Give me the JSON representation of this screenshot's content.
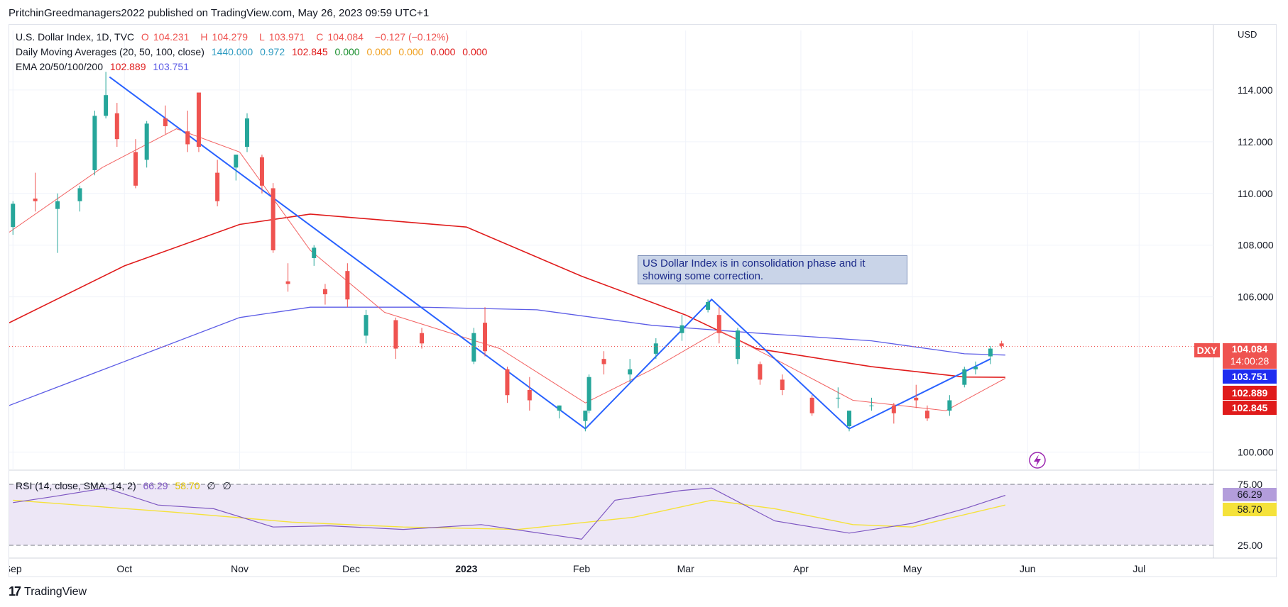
{
  "header": {
    "publisher": "PritchinGreedmanagers2022 published on TradingView.com, May 26, 2023 09:59 UTC+1"
  },
  "legend": {
    "symbol": "U.S. Dollar Index, 1D, TVC",
    "o_label": "O",
    "o": "104.231",
    "h_label": "H",
    "h": "104.279",
    "l_label": "L",
    "l": "103.971",
    "c_label": "C",
    "c": "104.084",
    "change": "−0.127 (−0.12%)",
    "ma_label": "Daily Moving Averages (20, 50, 100, close)",
    "ma_values": [
      "1440.000",
      "0.972",
      "102.845",
      "0.000",
      "0.000",
      "0.000",
      "0.000",
      "0.000"
    ],
    "ema_label": "EMA 20/50/100/200",
    "ema_values": [
      "102.889",
      "103.751"
    ],
    "rsi_label": "RSI (14, close, SMA, 14, 2)",
    "rsi_values": [
      "66.29",
      "58.70",
      "∅",
      "∅"
    ]
  },
  "annotation": {
    "line1": "US Dollar Index is in consolidation phase and it",
    "line2": "showing some correction."
  },
  "price_axis": {
    "currency": "USD",
    "ticks": [
      "114.000",
      "112.000",
      "110.000",
      "108.000",
      "106.000",
      "100.000"
    ]
  },
  "rsi_axis": {
    "ticks": [
      "75.00",
      "25.00"
    ]
  },
  "time_axis": {
    "labels": [
      "Sep",
      "Oct",
      "Nov",
      "Dec",
      "2023",
      "Feb",
      "Mar",
      "Apr",
      "May",
      "Jun",
      "Jul"
    ]
  },
  "price_tags": {
    "symbol": "DXY",
    "last": "104.084",
    "countdown": "14:00:28",
    "ema_blue": "103.751",
    "ema_red1": "102.889",
    "ma_red2": "102.845",
    "rsi": "66.29",
    "rsi_sma": "58.70"
  },
  "footer": {
    "brand": "TradingView"
  },
  "colors": {
    "up": "#26a69a",
    "down": "#ef5350",
    "ema_slow": "#5c5ce6",
    "ema_mid": "#e01b1b",
    "ema_fast": "#f26363",
    "trend": "#2962ff",
    "rsi": "#7e57c2",
    "rsi_sma": "#f5e23a"
  },
  "chart_data": {
    "type": "candlestick",
    "title": "U.S. Dollar Index, 1D, TVC",
    "y_range": [
      99.3,
      116.3
    ],
    "x_range": [
      "2022-08-31",
      "2023-07-21"
    ],
    "ohlc": [
      [
        "2022-09-01",
        108.7,
        109.7,
        108.4,
        109.6
      ],
      [
        "2022-09-07",
        109.8,
        110.8,
        109.3,
        109.7
      ],
      [
        "2022-09-13",
        109.4,
        110.0,
        107.7,
        109.7
      ],
      [
        "2022-09-19",
        109.7,
        110.3,
        109.3,
        110.2
      ],
      [
        "2022-09-23",
        110.9,
        113.2,
        110.7,
        113.0
      ],
      [
        "2022-09-26",
        113.0,
        114.7,
        112.9,
        113.8
      ],
      [
        "2022-09-29",
        113.1,
        113.5,
        111.8,
        112.1
      ],
      [
        "2022-10-04",
        111.6,
        112.1,
        110.2,
        110.3
      ],
      [
        "2022-10-07",
        111.3,
        112.8,
        111.0,
        112.7
      ],
      [
        "2022-10-12",
        112.9,
        113.4,
        112.3,
        112.6
      ],
      [
        "2022-10-18",
        112.4,
        113.2,
        111.6,
        111.9
      ],
      [
        "2022-10-21",
        113.9,
        113.9,
        111.6,
        111.8
      ],
      [
        "2022-10-26",
        110.8,
        111.3,
        109.5,
        109.7
      ],
      [
        "2022-10-31",
        111.0,
        111.5,
        110.5,
        111.5
      ],
      [
        "2022-11-03",
        111.8,
        113.1,
        111.6,
        112.9
      ],
      [
        "2022-11-07",
        111.4,
        111.5,
        110.0,
        110.3
      ],
      [
        "2022-11-10",
        110.2,
        110.4,
        107.7,
        107.8
      ],
      [
        "2022-11-14",
        106.6,
        107.3,
        106.2,
        106.5
      ],
      [
        "2022-11-21",
        107.5,
        108.0,
        107.2,
        107.9
      ],
      [
        "2022-11-24",
        106.3,
        106.5,
        105.7,
        106.1
      ],
      [
        "2022-11-30",
        107.0,
        107.3,
        105.6,
        105.9
      ],
      [
        "2022-12-05",
        104.5,
        105.5,
        104.2,
        105.3
      ],
      [
        "2022-12-13",
        105.1,
        105.2,
        103.6,
        104.0
      ],
      [
        "2022-12-20",
        104.6,
        104.8,
        104.0,
        104.2
      ],
      [
        "2023-01-03",
        103.5,
        104.8,
        103.4,
        104.6
      ],
      [
        "2023-01-06",
        105.0,
        105.6,
        103.7,
        103.9
      ],
      [
        "2023-01-12",
        103.2,
        103.3,
        101.9,
        102.2
      ],
      [
        "2023-01-18",
        102.4,
        102.9,
        101.6,
        102.0
      ],
      [
        "2023-01-26",
        101.6,
        101.8,
        101.3,
        101.8
      ],
      [
        "2023-02-02",
        101.2,
        101.6,
        100.8,
        101.6
      ],
      [
        "2023-02-03",
        101.6,
        103.0,
        101.5,
        102.9
      ],
      [
        "2023-02-07",
        103.6,
        103.9,
        103.0,
        103.4
      ],
      [
        "2023-02-14",
        103.0,
        103.6,
        102.7,
        103.2
      ],
      [
        "2023-02-21",
        103.8,
        104.4,
        103.6,
        104.2
      ],
      [
        "2023-02-28",
        104.6,
        105.3,
        104.3,
        104.9
      ],
      [
        "2023-03-07",
        105.5,
        105.9,
        105.4,
        105.8
      ],
      [
        "2023-03-10",
        105.3,
        105.6,
        104.2,
        104.6
      ],
      [
        "2023-03-15",
        103.6,
        104.8,
        103.4,
        104.7
      ],
      [
        "2023-03-21",
        103.4,
        103.5,
        102.6,
        102.8
      ],
      [
        "2023-03-27",
        102.8,
        103.0,
        102.2,
        102.4
      ],
      [
        "2023-04-04",
        102.1,
        102.2,
        101.4,
        101.5
      ],
      [
        "2023-04-11",
        102.1,
        102.5,
        101.7,
        102.1
      ],
      [
        "2023-04-14",
        101.0,
        101.6,
        100.8,
        101.6
      ],
      [
        "2023-04-20",
        101.8,
        102.1,
        101.6,
        101.8
      ],
      [
        "2023-04-26",
        101.8,
        101.9,
        101.1,
        101.5
      ],
      [
        "2023-05-02",
        102.1,
        102.6,
        101.7,
        102.0
      ],
      [
        "2023-05-05",
        101.6,
        101.8,
        101.2,
        101.3
      ],
      [
        "2023-05-11",
        101.6,
        102.2,
        101.4,
        102.0
      ],
      [
        "2023-05-15",
        102.6,
        103.3,
        102.5,
        103.2
      ],
      [
        "2023-05-18",
        103.2,
        103.5,
        103.0,
        103.3
      ],
      [
        "2023-05-22",
        103.7,
        104.1,
        103.4,
        104.0
      ],
      [
        "2023-05-25",
        104.2,
        104.3,
        104.0,
        104.1
      ]
    ],
    "series": [
      {
        "name": "EMA 200",
        "values": [
          [
            "2022-08-31",
            101.8
          ],
          [
            "2022-10-01",
            103.5
          ],
          [
            "2022-11-01",
            105.2
          ],
          [
            "2022-11-20",
            105.6
          ],
          [
            "2022-12-20",
            105.6
          ],
          [
            "2023-01-20",
            105.5
          ],
          [
            "2023-02-20",
            104.9
          ],
          [
            "2023-03-20",
            104.6
          ],
          [
            "2023-04-20",
            104.3
          ],
          [
            "2023-05-15",
            103.8
          ],
          [
            "2023-05-26",
            103.75
          ]
        ]
      },
      {
        "name": "EMA 100",
        "values": [
          [
            "2022-08-31",
            105.0
          ],
          [
            "2022-10-01",
            107.2
          ],
          [
            "2022-11-01",
            108.8
          ],
          [
            "2022-11-20",
            109.2
          ],
          [
            "2023-01-01",
            108.7
          ],
          [
            "2023-02-01",
            106.8
          ],
          [
            "2023-03-01",
            105.3
          ],
          [
            "2023-03-20",
            104.0
          ],
          [
            "2023-04-20",
            103.3
          ],
          [
            "2023-05-15",
            102.9
          ],
          [
            "2023-05-26",
            102.89
          ]
        ]
      },
      {
        "name": "MA 20",
        "values": [
          [
            "2022-08-31",
            108.5
          ],
          [
            "2022-09-25",
            111.0
          ],
          [
            "2022-10-15",
            112.5
          ],
          [
            "2022-11-01",
            111.6
          ],
          [
            "2022-11-20",
            107.8
          ],
          [
            "2022-12-10",
            105.4
          ],
          [
            "2023-01-10",
            104.0
          ],
          [
            "2023-02-02",
            101.9
          ],
          [
            "2023-02-20",
            103.2
          ],
          [
            "2023-03-10",
            104.7
          ],
          [
            "2023-03-25",
            103.6
          ],
          [
            "2023-04-15",
            102.0
          ],
          [
            "2023-05-10",
            101.6
          ],
          [
            "2023-05-26",
            102.85
          ]
        ]
      },
      {
        "name": "Trend",
        "values": [
          [
            "2022-09-27",
            114.5
          ],
          [
            "2023-02-02",
            100.9
          ],
          [
            "2023-03-08",
            105.9
          ],
          [
            "2023-04-14",
            100.9
          ],
          [
            "2023-05-22",
            103.6
          ]
        ]
      }
    ],
    "rsi": {
      "y_range": [
        25,
        75
      ],
      "values": [
        [
          "2022-09-01",
          60
        ],
        [
          "2022-09-12",
          65
        ],
        [
          "2022-09-26",
          72
        ],
        [
          "2022-10-10",
          58
        ],
        [
          "2022-10-25",
          55
        ],
        [
          "2022-11-10",
          40
        ],
        [
          "2022-11-25",
          41
        ],
        [
          "2022-12-15",
          38
        ],
        [
          "2023-01-05",
          42
        ],
        [
          "2023-02-01",
          30
        ],
        [
          "2023-02-10",
          62
        ],
        [
          "2023-02-28",
          70
        ],
        [
          "2023-03-08",
          72
        ],
        [
          "2023-03-25",
          45
        ],
        [
          "2023-04-14",
          35
        ],
        [
          "2023-05-01",
          43
        ],
        [
          "2023-05-15",
          55
        ],
        [
          "2023-05-26",
          66
        ]
      ],
      "sma": [
        [
          "2022-09-01",
          62
        ],
        [
          "2022-10-15",
          52
        ],
        [
          "2022-11-15",
          44
        ],
        [
          "2022-12-15",
          40
        ],
        [
          "2023-01-15",
          38
        ],
        [
          "2023-02-15",
          48
        ],
        [
          "2023-03-08",
          62
        ],
        [
          "2023-03-25",
          55
        ],
        [
          "2023-04-15",
          42
        ],
        [
          "2023-05-01",
          40
        ],
        [
          "2023-05-26",
          58
        ]
      ]
    }
  }
}
